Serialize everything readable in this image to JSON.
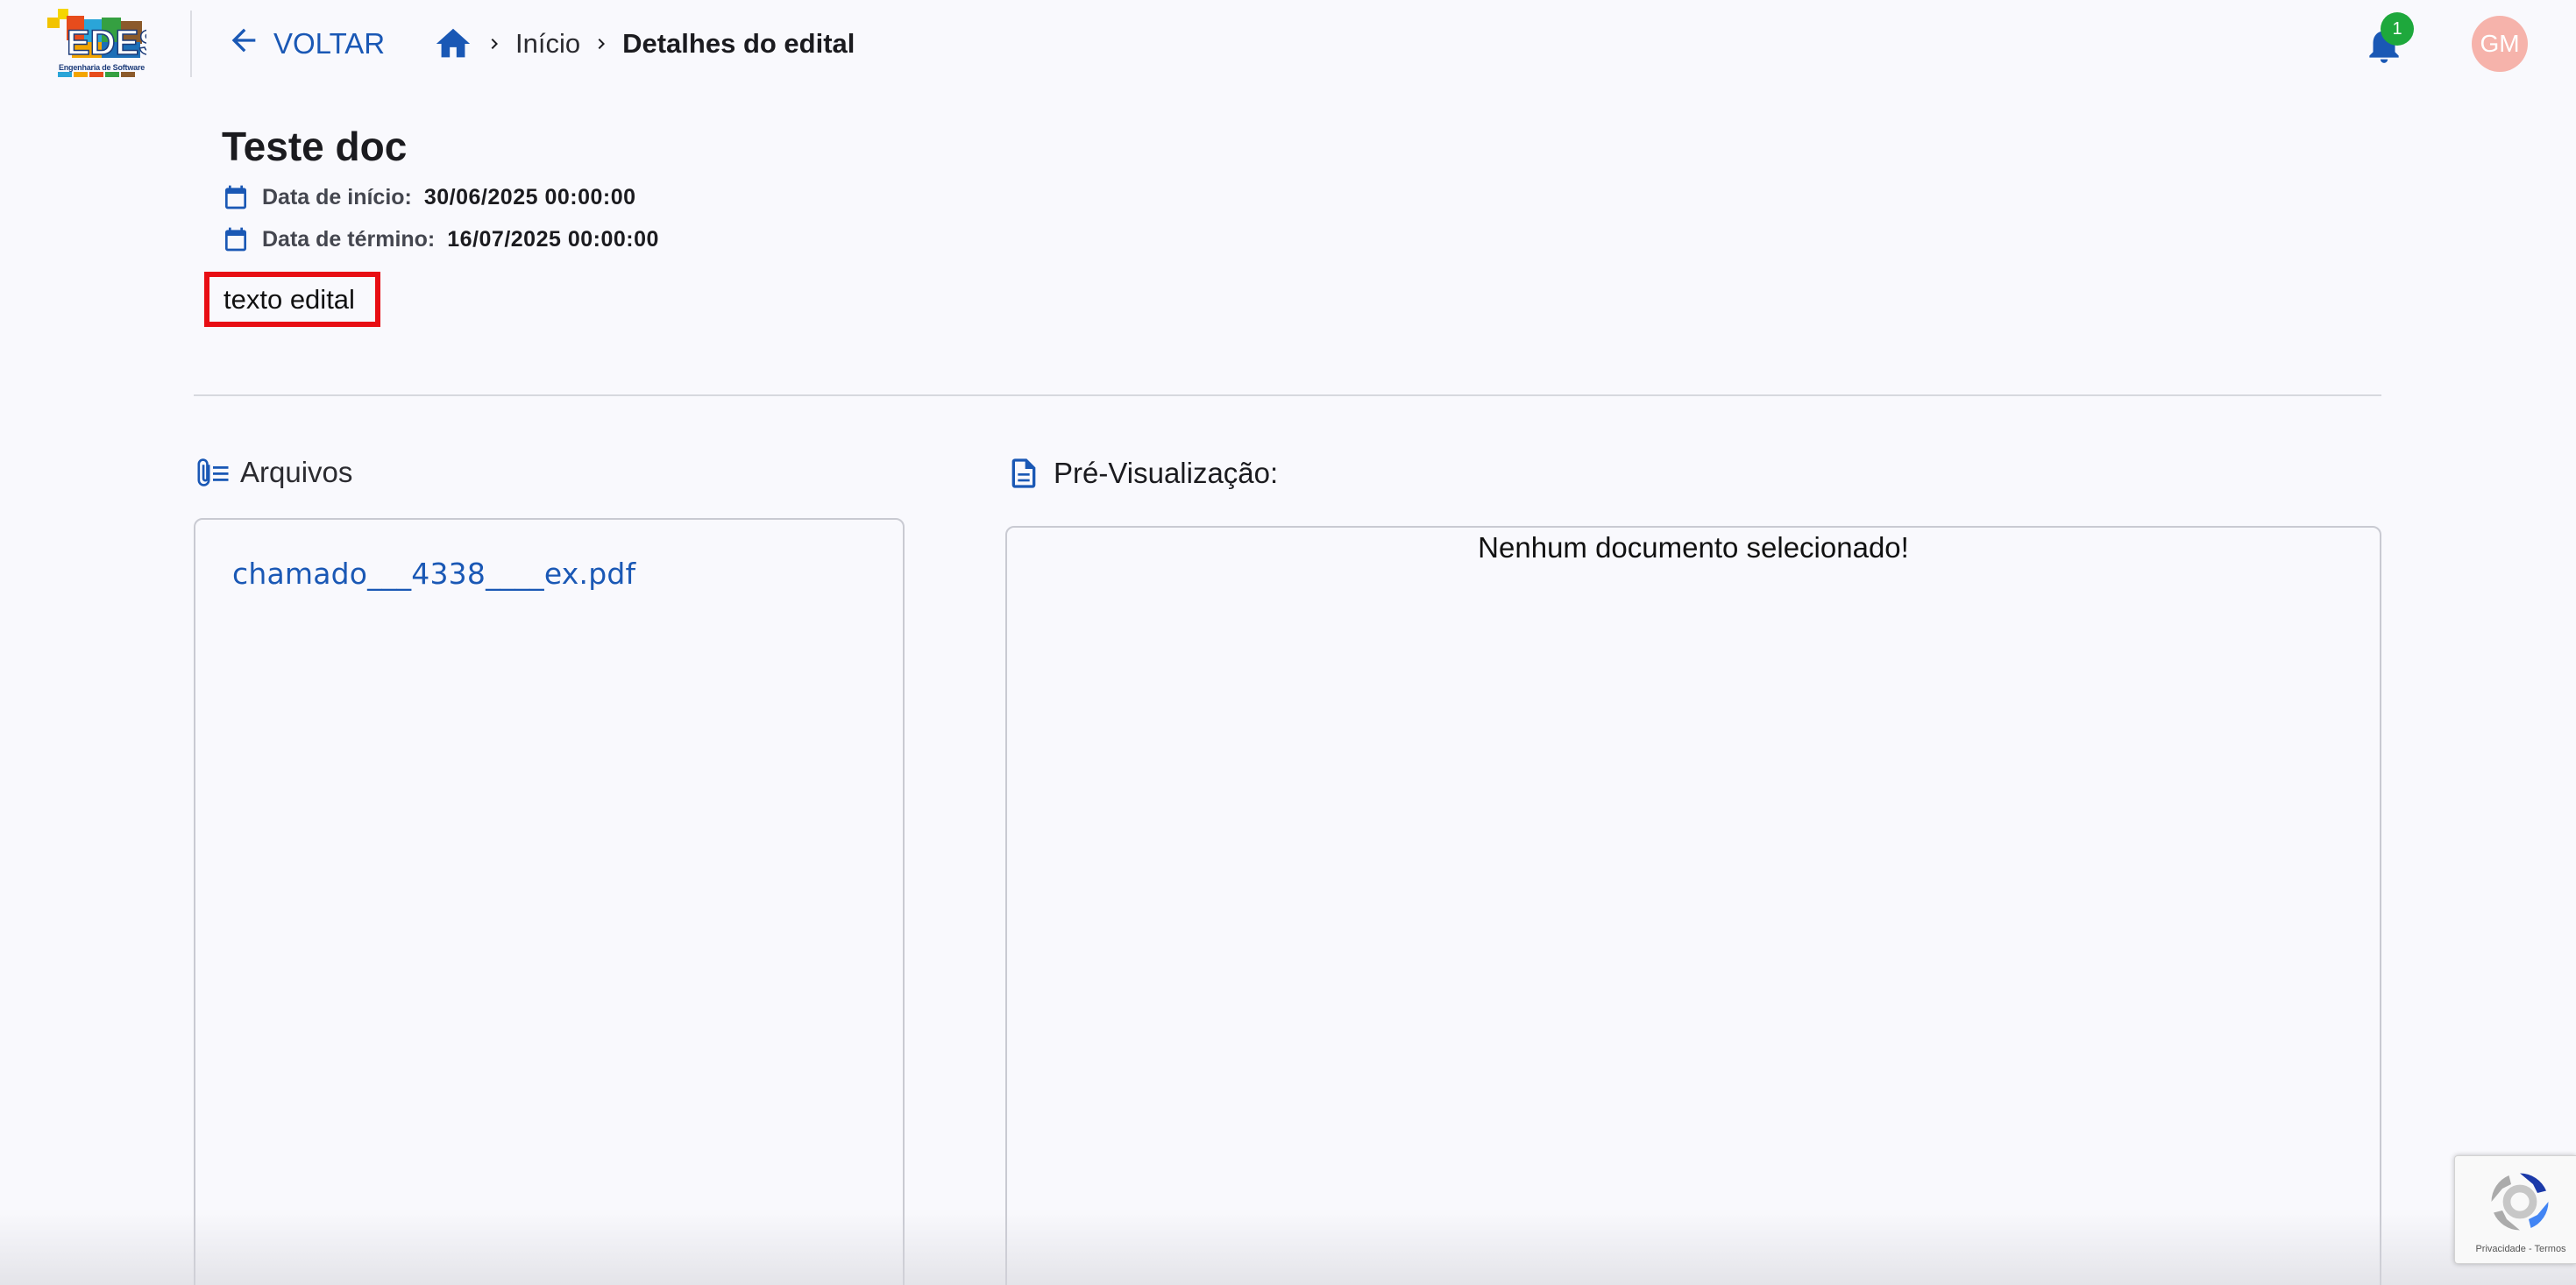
{
  "header": {
    "logo_text": "EDES",
    "logo_subtitle": "Engenharia de Software",
    "back_label": "VOLTAR",
    "breadcrumb": {
      "home_icon": "home-icon",
      "items": [
        "Início",
        "Detalhes do edital"
      ]
    },
    "notifications": {
      "icon": "bell-icon",
      "count": "1"
    },
    "avatar_initials": "GM"
  },
  "edital": {
    "title": "Teste doc",
    "start_label": "Data de início:",
    "start_value": "30/06/2025 00:00:00",
    "end_label": "Data de término:",
    "end_value": "16/07/2025 00:00:00",
    "text": "texto edital"
  },
  "files": {
    "heading": "Arquivos",
    "items": [
      "chamado___4338____ex.pdf"
    ]
  },
  "preview": {
    "heading": "Pré-Visualização:",
    "empty_message": "Nenhum documento selecionado!"
  },
  "recaptcha": {
    "privacy": "Privacidade",
    "separator": " - ",
    "terms": "Termos"
  },
  "colors": {
    "primary": "#1a58b5",
    "highlight_border": "#e80e14",
    "badge": "#1ea83c",
    "avatar": "#f6b3ab"
  }
}
